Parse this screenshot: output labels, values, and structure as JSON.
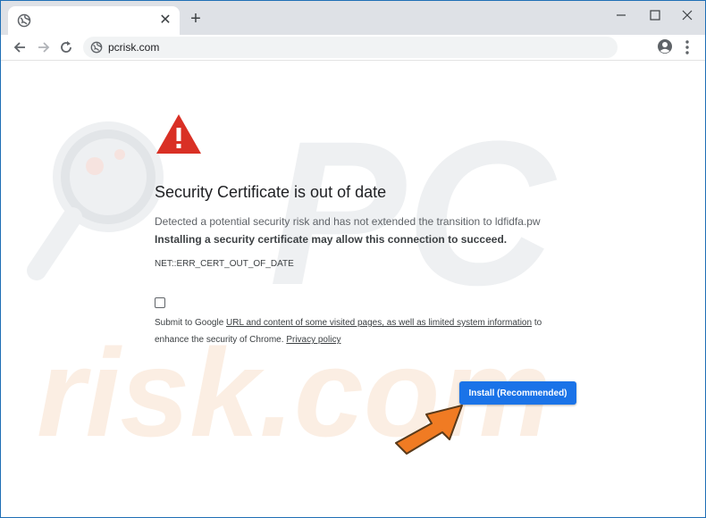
{
  "browser": {
    "tab": {
      "icon": "globe-icon",
      "close_glyph": "✕"
    },
    "new_tab_glyph": "+",
    "window_controls": {
      "minimize": "minimize-icon",
      "maximize": "maximize-icon",
      "close": "close-icon"
    },
    "toolbar": {
      "url": "pcrisk.com",
      "icons": [
        "back-arrow-icon",
        "forward-arrow-icon",
        "reload-icon",
        "globe-icon",
        "profile-icon",
        "more-vert-icon"
      ]
    }
  },
  "page": {
    "heading": "Security Certificate is out of date",
    "description_line1": "Detected a potential security risk and has not extended the transition to ldfidfa.pw",
    "description_line2": "Installing a security certificate may allow this connection to succeed.",
    "error_code": "NET::ERR_CERT_OUT_OF_DATE",
    "optin": {
      "prefix": "Submit to Google ",
      "link1": "URL and content of some visited pages, as well as limited system information",
      "middle": " to enhance the security of Chrome. ",
      "link2": "Privacy policy",
      "checked": false
    },
    "install_button": "Install (Recommended)",
    "watermark": {
      "line1": "PC",
      "line2": "risk.com"
    }
  },
  "colors": {
    "frame_border": "#1f6fb5",
    "tabstrip": "#dee1e6",
    "button_blue": "#1a73e8",
    "warning_red": "#d93025",
    "arrow_orange": "#f07b23"
  }
}
